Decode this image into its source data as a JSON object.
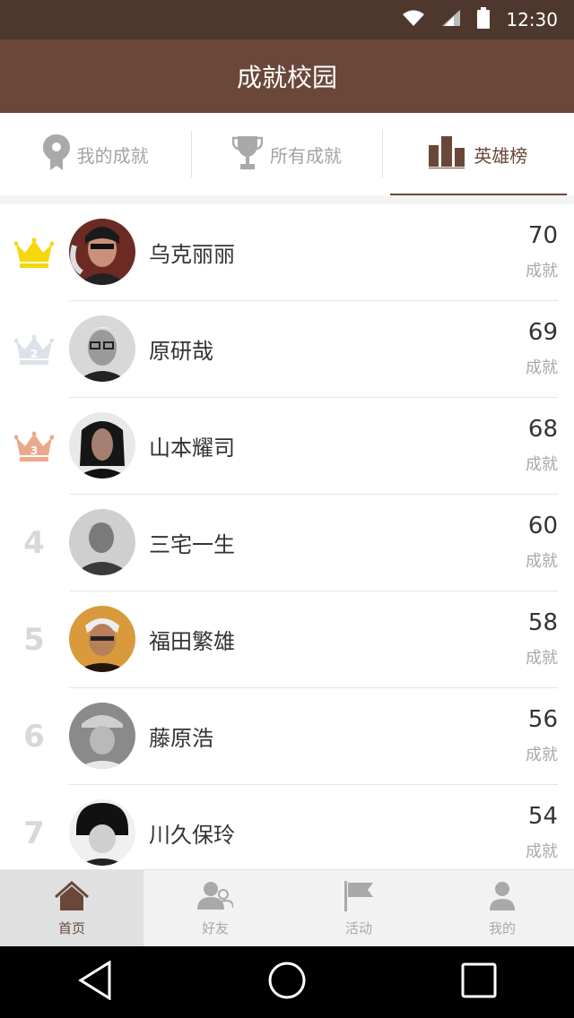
{
  "status_bar": {
    "time": "12:30"
  },
  "app_bar": {
    "title": "成就校园"
  },
  "tabs": [
    {
      "label": "我的成就",
      "icon": "map-pin-icon"
    },
    {
      "label": "所有成就",
      "icon": "trophy-icon"
    },
    {
      "label": "英雄榜",
      "icon": "bar-chart-icon",
      "active": true
    }
  ],
  "ranking": [
    {
      "rank": "1",
      "rank_badge": "gold-crown-icon",
      "name": "乌克丽丽",
      "score": "70",
      "unit": "成就"
    },
    {
      "rank": "2",
      "rank_badge": "silver-crown-icon",
      "name": "原研哉",
      "score": "69",
      "unit": "成就"
    },
    {
      "rank": "3",
      "rank_badge": "bronze-crown-icon",
      "name": "山本耀司",
      "score": "68",
      "unit": "成就"
    },
    {
      "rank": "4",
      "name": "三宅一生",
      "score": "60",
      "unit": "成就"
    },
    {
      "rank": "5",
      "name": "福田繁雄",
      "score": "58",
      "unit": "成就"
    },
    {
      "rank": "6",
      "name": "藤原浩",
      "score": "56",
      "unit": "成就"
    },
    {
      "rank": "7",
      "name": "川久保玲",
      "score": "54",
      "unit": "成就"
    }
  ],
  "bottom_nav": [
    {
      "label": "首页",
      "icon": "home-icon",
      "active": true
    },
    {
      "label": "好友",
      "icon": "friends-icon"
    },
    {
      "label": "活动",
      "icon": "flag-icon"
    },
    {
      "label": "我的",
      "icon": "profile-icon"
    }
  ],
  "colors": {
    "brand": "#6b4739",
    "status_bar": "#4e382d",
    "gold": "#f5d80c",
    "silver": "#dde1ea",
    "bronze": "#eca98a"
  }
}
